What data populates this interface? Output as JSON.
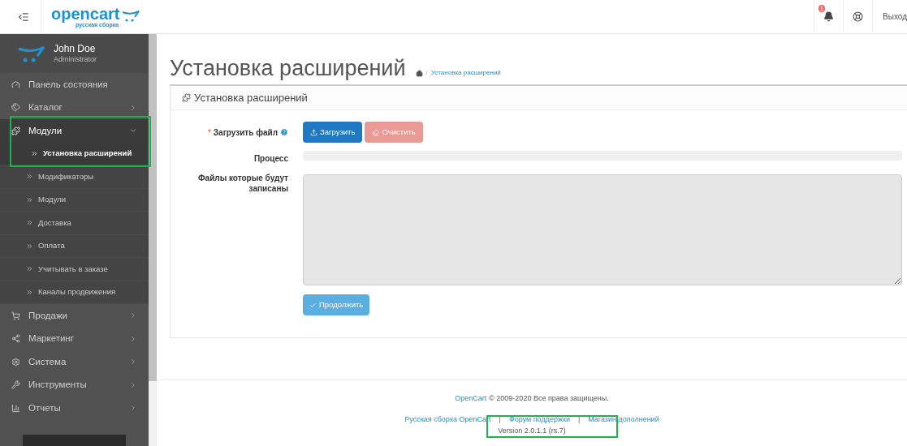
{
  "header": {
    "logo": {
      "name": "opencart",
      "tagline": "русская сборка"
    },
    "notifications": {
      "count": "1"
    },
    "logout": "Выход"
  },
  "profile": {
    "name": "John Doe",
    "role": "Administrator"
  },
  "sidebar": {
    "items": [
      {
        "label": "Панель состояния",
        "arrow": false,
        "expanded": false
      },
      {
        "label": "Каталог",
        "arrow": true,
        "expanded": false
      },
      {
        "label": "Модули",
        "arrow": true,
        "expanded": true,
        "children": [
          {
            "label": "Установка расширений",
            "selected": true
          },
          {
            "label": "Модификаторы",
            "selected": false
          },
          {
            "label": "Модули",
            "selected": false
          },
          {
            "label": "Доставка",
            "selected": false
          },
          {
            "label": "Оплата",
            "selected": false
          },
          {
            "label": "Учитывать в заказе",
            "selected": false
          },
          {
            "label": "Каналы продвижения",
            "selected": false
          }
        ]
      },
      {
        "label": "Продажи",
        "arrow": true,
        "expanded": false
      },
      {
        "label": "Маркетинг",
        "arrow": true,
        "expanded": false
      },
      {
        "label": "Система",
        "arrow": true,
        "expanded": false
      },
      {
        "label": "Инструменты",
        "arrow": true,
        "expanded": false
      },
      {
        "label": "Отчеты",
        "arrow": true,
        "expanded": false
      }
    ]
  },
  "page": {
    "title": "Установка расширений",
    "breadcrumb_separator": "/",
    "breadcrumb": [
      "Установка расширений"
    ]
  },
  "panel": {
    "title": "Установка расширений",
    "upload": {
      "label": "Загрузить файл",
      "required": true,
      "required_mark": "*",
      "upload_button": "Загрузить",
      "clear_button": "Очистить",
      "clear_disabled": true
    },
    "progress": {
      "label": "Процесс",
      "level": 0
    },
    "files": {
      "label": "Файлы которые будут записаны"
    },
    "continue_button": "Продолжить"
  },
  "footer": {
    "brand_link": "OpenCart",
    "copyright": "© 2009-2020 Все права защищены.",
    "links": [
      "Русская сборка OpenCart",
      "Форум поддержки",
      "Магазин дополнений"
    ],
    "separator": "|",
    "version": "Version 2.0.1.1 (rs.7)"
  }
}
